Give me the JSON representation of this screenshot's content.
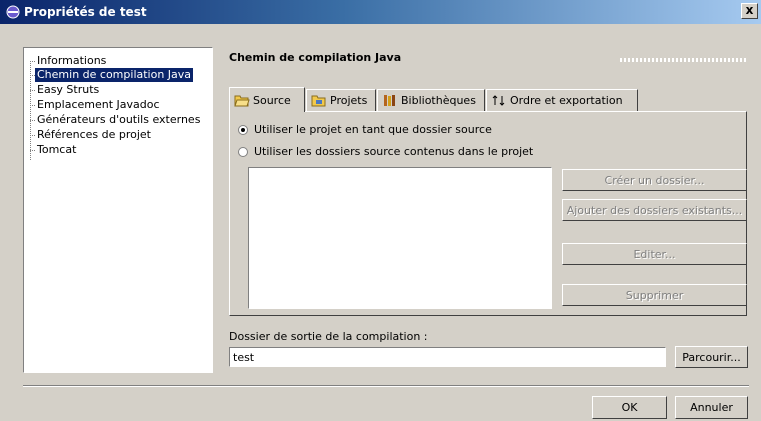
{
  "window": {
    "title": "Propriétés de test",
    "close_label": "x"
  },
  "tree": {
    "items": [
      {
        "label": "Informations",
        "selected": false
      },
      {
        "label": "Chemin de compilation Java",
        "selected": true
      },
      {
        "label": "Easy Struts",
        "selected": false
      },
      {
        "label": "Emplacement Javadoc",
        "selected": false
      },
      {
        "label": "Générateurs d'outils externes",
        "selected": false
      },
      {
        "label": "Références de projet",
        "selected": false
      },
      {
        "label": "Tomcat",
        "selected": false
      }
    ]
  },
  "page": {
    "title": "Chemin de compilation Java"
  },
  "tabs": [
    {
      "label": "Source",
      "icon": "folder-open-icon",
      "active": true
    },
    {
      "label": "Projets",
      "icon": "projects-folder-icon",
      "active": false
    },
    {
      "label": "Bibliothèques",
      "icon": "books-icon",
      "active": false
    },
    {
      "label": "Ordre et exportation",
      "icon": "sort-arrows-icon",
      "active": false
    }
  ],
  "source": {
    "radio_use_project": "Utiliser le projet en tant que dossier source",
    "radio_use_folders": "Utiliser les dossiers source contenus dans le projet",
    "buttons": {
      "create_folder": "Créer un dossier...",
      "add_existing": "Ajouter des dossiers existants...",
      "edit": "Editer...",
      "remove": "Supprimer"
    }
  },
  "output": {
    "label": "Dossier de sortie de la compilation :",
    "value": "test",
    "browse_label": "Parcourir..."
  },
  "footer": {
    "ok_label": "OK",
    "cancel_label": "Annuler"
  },
  "colors": {
    "titlebar": "#0a246a",
    "selection": "#0a246a",
    "face": "#d4d0c8"
  }
}
